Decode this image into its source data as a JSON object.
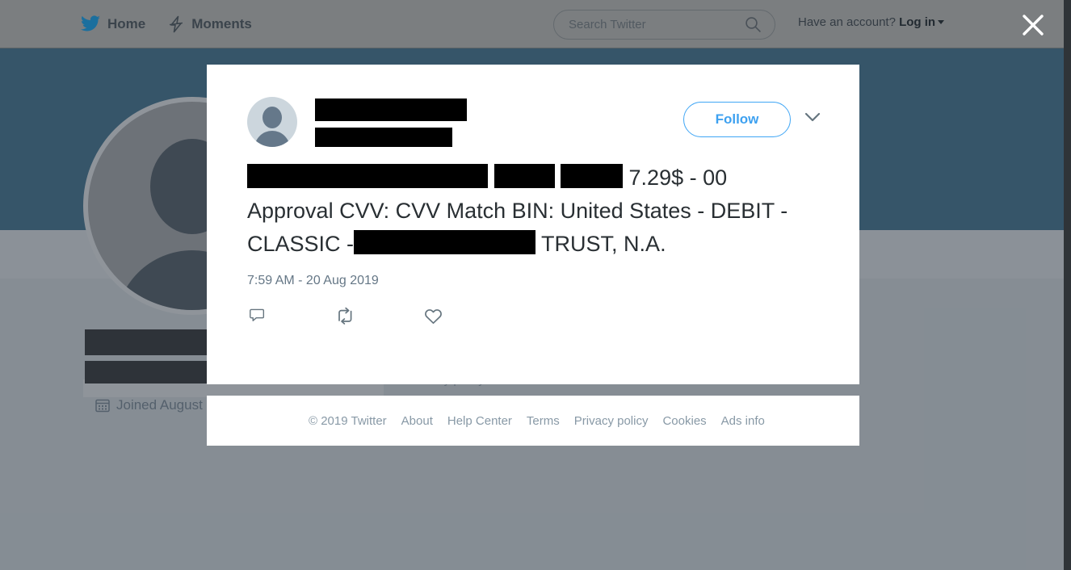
{
  "nav": {
    "home_label": "Home",
    "home_icon": "twitter-bird-icon",
    "moments_label": "Moments",
    "moments_icon": "lightning-bolt-icon",
    "search_placeholder": "Search Twitter",
    "search_value": "",
    "search_icon": "search-icon",
    "account_prompt": "Have an account?",
    "login_label": "Log in",
    "close_icon": "close-icon",
    "bg_color": "#7b7e80"
  },
  "background": {
    "banner_color": "#15597f",
    "profile_nav_color": "#f5f8fa",
    "body_color": "#e6ecf0",
    "avatar_icon": "default-profile-avatar-icon",
    "name_redacted": true,
    "handle_redacted": true,
    "joined_label": "Joined August",
    "joined_icon": "calendar-icon",
    "footer_peek_text": "Privacy policy    Cookies"
  },
  "modal": {
    "avatar_icon": "default-profile-avatar-icon",
    "display_name_redacted": true,
    "handle_redacted": true,
    "follow_label": "Follow",
    "follow_color": "#3ea1f0",
    "more_icon": "chevron-down-icon",
    "tweet_text_visible": "7.29$ - 00 Approval CVV: CVV Match BIN: United States - DEBIT - CLASSIC - TRUST, N.A.",
    "tweet_segments": [
      {
        "type": "redaction",
        "id": "rd1"
      },
      {
        "type": "redaction",
        "id": "rd2"
      },
      {
        "type": "redaction",
        "id": "rd3"
      },
      {
        "type": "text",
        "value": " 7.29$ - 00 Approval CVV: CVV Match BIN: United States - DEBIT - CLASSIC -"
      },
      {
        "type": "redaction",
        "id": "rd4"
      },
      {
        "type": "text",
        "value": " TRUST, N.A."
      }
    ],
    "text_part_a": " 7.29$ - 00 Approval CVV: CVV Match BIN: United States - DEBIT - CLASSIC -",
    "text_part_b": " TRUST, N.A.",
    "timestamp": "7:59 AM - 20 Aug 2019",
    "reply_icon": "reply-icon",
    "retweet_icon": "retweet-icon",
    "like_icon": "heart-icon"
  },
  "footer": {
    "copyright": "© 2019 Twitter",
    "links": [
      "About",
      "Help Center",
      "Terms",
      "Privacy policy",
      "Cookies",
      "Ads info"
    ]
  }
}
